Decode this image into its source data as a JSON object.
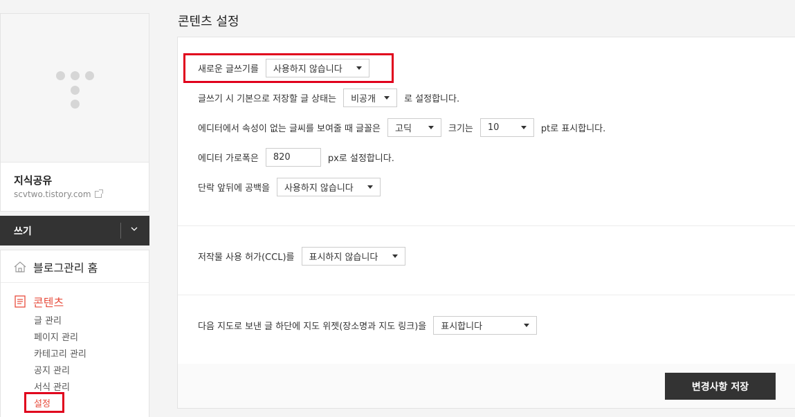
{
  "page_title": "콘텐츠 설정",
  "blog": {
    "name": "지식공유",
    "url": "scvtwo.tistory.com"
  },
  "write_button": "쓰기",
  "menu": {
    "home": "블로그관리 홈",
    "content": "콘텐츠",
    "sub_items": [
      "글 관리",
      "페이지 관리",
      "카테고리 관리",
      "공지 관리",
      "서식 관리",
      "설정"
    ]
  },
  "settings": {
    "new_editor": {
      "label": "새로운 글쓰기를",
      "value": "사용하지 않습니다"
    },
    "default_status": {
      "label": "글쓰기 시 기본으로 저장할 글 상태는",
      "value": "비공개",
      "suffix": "로 설정합니다."
    },
    "font": {
      "label": "에디터에서 속성이 없는 글씨를 보여줄 때 글꼴은",
      "font_value": "고딕",
      "size_label": "크기는",
      "size_value": "10",
      "suffix": "pt로 표시합니다."
    },
    "editor_width": {
      "label": "에디터 가로폭은",
      "value": "820",
      "suffix": "px로 설정합니다."
    },
    "paragraph": {
      "label": "단락 앞뒤에 공백을",
      "value": "사용하지 않습니다"
    },
    "ccl": {
      "label": "저작물 사용 허가(CCL)를",
      "value": "표시하지 않습니다"
    },
    "map_widget": {
      "label": "다음 지도로 보낸 글 하단에 지도 위젯(장소명과 지도 링크)을",
      "value": "표시합니다"
    }
  },
  "save_label": "변경사항 저장"
}
